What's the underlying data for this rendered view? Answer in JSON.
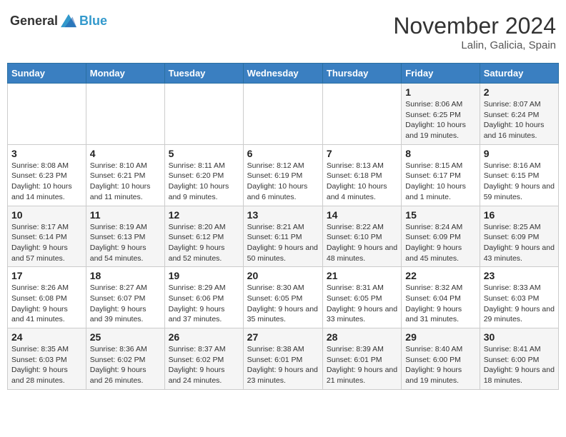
{
  "header": {
    "logo_general": "General",
    "logo_blue": "Blue",
    "month": "November 2024",
    "location": "Lalin, Galicia, Spain"
  },
  "weekdays": [
    "Sunday",
    "Monday",
    "Tuesday",
    "Wednesday",
    "Thursday",
    "Friday",
    "Saturday"
  ],
  "weeks": [
    [
      {
        "day": "",
        "info": ""
      },
      {
        "day": "",
        "info": ""
      },
      {
        "day": "",
        "info": ""
      },
      {
        "day": "",
        "info": ""
      },
      {
        "day": "",
        "info": ""
      },
      {
        "day": "1",
        "info": "Sunrise: 8:06 AM\nSunset: 6:25 PM\nDaylight: 10 hours and 19 minutes."
      },
      {
        "day": "2",
        "info": "Sunrise: 8:07 AM\nSunset: 6:24 PM\nDaylight: 10 hours and 16 minutes."
      }
    ],
    [
      {
        "day": "3",
        "info": "Sunrise: 8:08 AM\nSunset: 6:23 PM\nDaylight: 10 hours and 14 minutes."
      },
      {
        "day": "4",
        "info": "Sunrise: 8:10 AM\nSunset: 6:21 PM\nDaylight: 10 hours and 11 minutes."
      },
      {
        "day": "5",
        "info": "Sunrise: 8:11 AM\nSunset: 6:20 PM\nDaylight: 10 hours and 9 minutes."
      },
      {
        "day": "6",
        "info": "Sunrise: 8:12 AM\nSunset: 6:19 PM\nDaylight: 10 hours and 6 minutes."
      },
      {
        "day": "7",
        "info": "Sunrise: 8:13 AM\nSunset: 6:18 PM\nDaylight: 10 hours and 4 minutes."
      },
      {
        "day": "8",
        "info": "Sunrise: 8:15 AM\nSunset: 6:17 PM\nDaylight: 10 hours and 1 minute."
      },
      {
        "day": "9",
        "info": "Sunrise: 8:16 AM\nSunset: 6:15 PM\nDaylight: 9 hours and 59 minutes."
      }
    ],
    [
      {
        "day": "10",
        "info": "Sunrise: 8:17 AM\nSunset: 6:14 PM\nDaylight: 9 hours and 57 minutes."
      },
      {
        "day": "11",
        "info": "Sunrise: 8:19 AM\nSunset: 6:13 PM\nDaylight: 9 hours and 54 minutes."
      },
      {
        "day": "12",
        "info": "Sunrise: 8:20 AM\nSunset: 6:12 PM\nDaylight: 9 hours and 52 minutes."
      },
      {
        "day": "13",
        "info": "Sunrise: 8:21 AM\nSunset: 6:11 PM\nDaylight: 9 hours and 50 minutes."
      },
      {
        "day": "14",
        "info": "Sunrise: 8:22 AM\nSunset: 6:10 PM\nDaylight: 9 hours and 48 minutes."
      },
      {
        "day": "15",
        "info": "Sunrise: 8:24 AM\nSunset: 6:09 PM\nDaylight: 9 hours and 45 minutes."
      },
      {
        "day": "16",
        "info": "Sunrise: 8:25 AM\nSunset: 6:09 PM\nDaylight: 9 hours and 43 minutes."
      }
    ],
    [
      {
        "day": "17",
        "info": "Sunrise: 8:26 AM\nSunset: 6:08 PM\nDaylight: 9 hours and 41 minutes."
      },
      {
        "day": "18",
        "info": "Sunrise: 8:27 AM\nSunset: 6:07 PM\nDaylight: 9 hours and 39 minutes."
      },
      {
        "day": "19",
        "info": "Sunrise: 8:29 AM\nSunset: 6:06 PM\nDaylight: 9 hours and 37 minutes."
      },
      {
        "day": "20",
        "info": "Sunrise: 8:30 AM\nSunset: 6:05 PM\nDaylight: 9 hours and 35 minutes."
      },
      {
        "day": "21",
        "info": "Sunrise: 8:31 AM\nSunset: 6:05 PM\nDaylight: 9 hours and 33 minutes."
      },
      {
        "day": "22",
        "info": "Sunrise: 8:32 AM\nSunset: 6:04 PM\nDaylight: 9 hours and 31 minutes."
      },
      {
        "day": "23",
        "info": "Sunrise: 8:33 AM\nSunset: 6:03 PM\nDaylight: 9 hours and 29 minutes."
      }
    ],
    [
      {
        "day": "24",
        "info": "Sunrise: 8:35 AM\nSunset: 6:03 PM\nDaylight: 9 hours and 28 minutes."
      },
      {
        "day": "25",
        "info": "Sunrise: 8:36 AM\nSunset: 6:02 PM\nDaylight: 9 hours and 26 minutes."
      },
      {
        "day": "26",
        "info": "Sunrise: 8:37 AM\nSunset: 6:02 PM\nDaylight: 9 hours and 24 minutes."
      },
      {
        "day": "27",
        "info": "Sunrise: 8:38 AM\nSunset: 6:01 PM\nDaylight: 9 hours and 23 minutes."
      },
      {
        "day": "28",
        "info": "Sunrise: 8:39 AM\nSunset: 6:01 PM\nDaylight: 9 hours and 21 minutes."
      },
      {
        "day": "29",
        "info": "Sunrise: 8:40 AM\nSunset: 6:00 PM\nDaylight: 9 hours and 19 minutes."
      },
      {
        "day": "30",
        "info": "Sunrise: 8:41 AM\nSunset: 6:00 PM\nDaylight: 9 hours and 18 minutes."
      }
    ]
  ]
}
